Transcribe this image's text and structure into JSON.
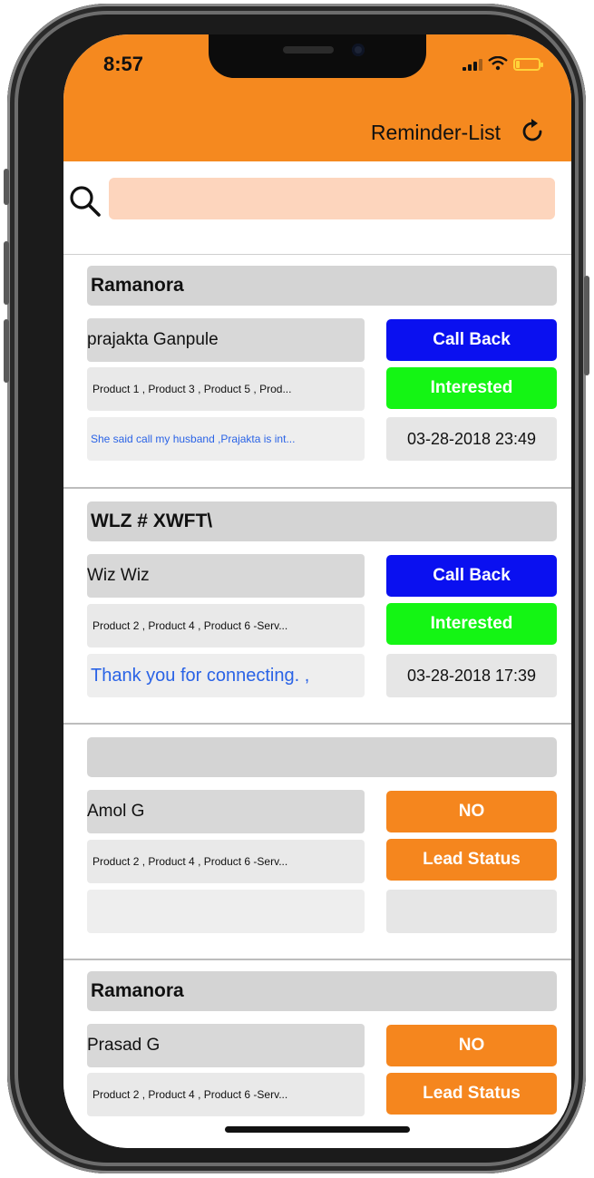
{
  "status": {
    "time": "8:57"
  },
  "header": {
    "title": "Reminder-List"
  },
  "search": {
    "placeholder": ""
  },
  "cards": [
    {
      "title": "Ramanora",
      "name": "prajakta Ganpule",
      "products": "Product 1 , Product 3 , Product 5 , Prod...",
      "note": "She said call my husband ,Prajakta is int...",
      "status_button": "Call Back",
      "lead_button": "Interested",
      "datetime": "03-28-2018 23:49"
    },
    {
      "title": "WLZ # XWFT\\",
      "name": "Wiz Wiz",
      "products": "Product 2 , Product 4 , Product 6 -Serv...",
      "note": "Thank you for connecting. ,",
      "status_button": "Call Back",
      "lead_button": "Interested",
      "datetime": "03-28-2018 17:39"
    },
    {
      "title": "",
      "name": "Amol G",
      "products": "Product 2 , Product 4 , Product 6 -Serv...",
      "note": "",
      "status_button": "NO",
      "lead_button": "Lead Status",
      "datetime": ""
    },
    {
      "title": "Ramanora",
      "name": "Prasad G",
      "products": "Product 2 , Product 4 , Product 6 -Serv...",
      "status_button": "NO",
      "lead_button": "Lead Status"
    }
  ],
  "colors": {
    "header": "#f5891f",
    "call_back": "#0a10f0",
    "interested": "#14f514",
    "orange_button": "#f5861e",
    "search_field": "#fdd5bd",
    "note_text": "#2a63e6"
  },
  "icons": {
    "search": "search-icon",
    "refresh": "refresh-icon",
    "signal": "signal-icon",
    "wifi": "wifi-icon",
    "battery": "battery-icon"
  }
}
